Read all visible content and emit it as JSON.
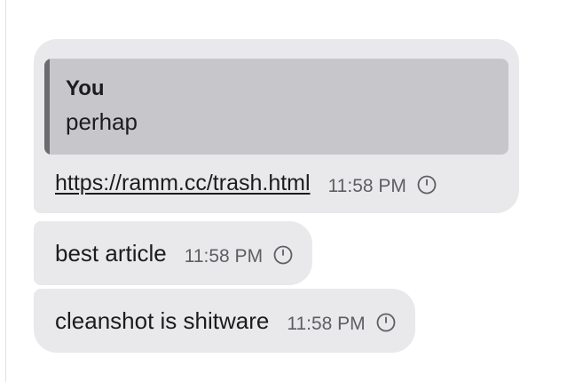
{
  "messages": [
    {
      "reply": {
        "author": "You",
        "text": "perhap"
      },
      "text": "https://ramm.cc/trash.html",
      "time": "11:58 PM",
      "status_icon": "clock-icon"
    },
    {
      "text": "best article",
      "time": "11:58 PM",
      "status_icon": "clock-icon"
    },
    {
      "text": "cleanshot is shitware",
      "time": "11:58 PM",
      "status_icon": "clock-icon"
    }
  ],
  "colors": {
    "bubble": "#e9e9eb",
    "reply_background": "#c7c7cb",
    "reply_bar": "#6b6b70",
    "text": "#1c1c1e",
    "time": "#5e5e63"
  }
}
